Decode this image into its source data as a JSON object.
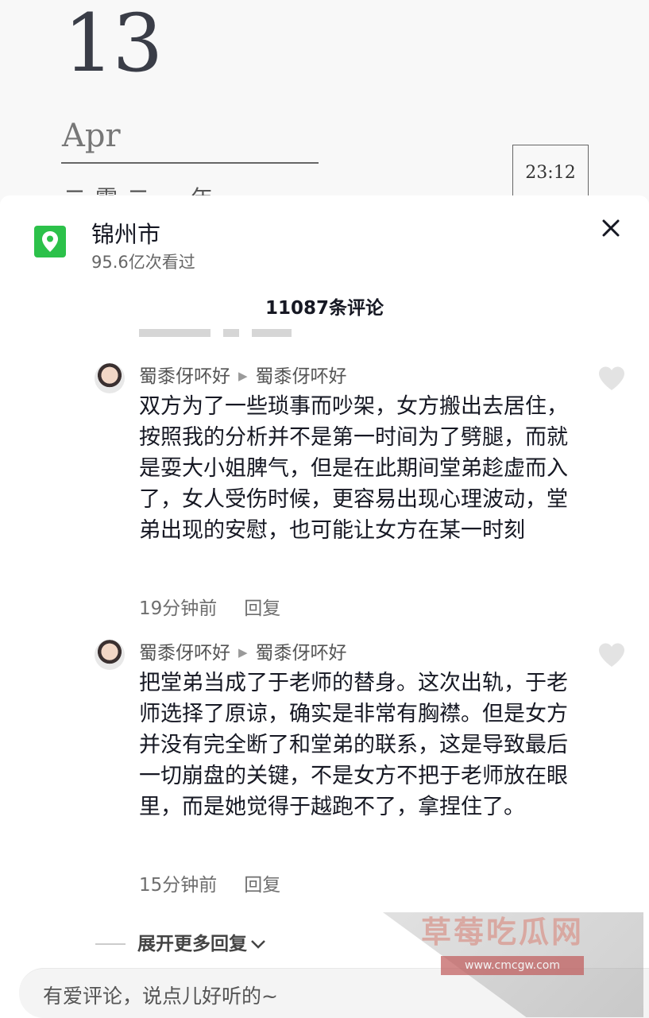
{
  "background": {
    "day": "13",
    "month": "Apr",
    "year_partial": "二零二一年",
    "time": "23:12"
  },
  "location": {
    "title": "锦州市",
    "views": "95.6亿次看过",
    "icon": "map-pin-icon"
  },
  "header": {
    "comments_count": "11087条评论"
  },
  "comments": [
    {
      "user": "蜀黍伢吥好",
      "reply_to": "蜀黍伢吥好",
      "text": "双方为了一些琐事而吵架，女方搬出去居住，按照我的分析并不是第一时间为了劈腿，而就是耍大小姐脾气，但是在此期间堂弟趁虚而入了，女人受伤时候，更容易出现心理波动，堂弟出现的安慰，也可能让女方在某一时刻",
      "time": "19分钟前",
      "reply_label": "回复"
    },
    {
      "user": "蜀黍伢吥好",
      "reply_to": "蜀黍伢吥好",
      "text": "把堂弟当成了于老师的替身。这次出轨，于老师选择了原谅，确实是非常有胸襟。但是女方并没有完全断了和堂弟的联系，这是导致最后一切崩盘的关键，不是女方不把于老师放在眼里，而是她觉得于越跑不了，拿捏住了。",
      "time": "15分钟前",
      "reply_label": "回复"
    }
  ],
  "expand_label": "展开更多回复",
  "input": {
    "placeholder": "有爱评论，说点儿好听的~"
  },
  "watermark": {
    "text": "草莓吃瓜网",
    "url": "www.cmcgw.com"
  },
  "colors": {
    "location_icon": "#2cc14a",
    "text_primary": "#161823",
    "text_secondary": "#6e6e6e"
  }
}
